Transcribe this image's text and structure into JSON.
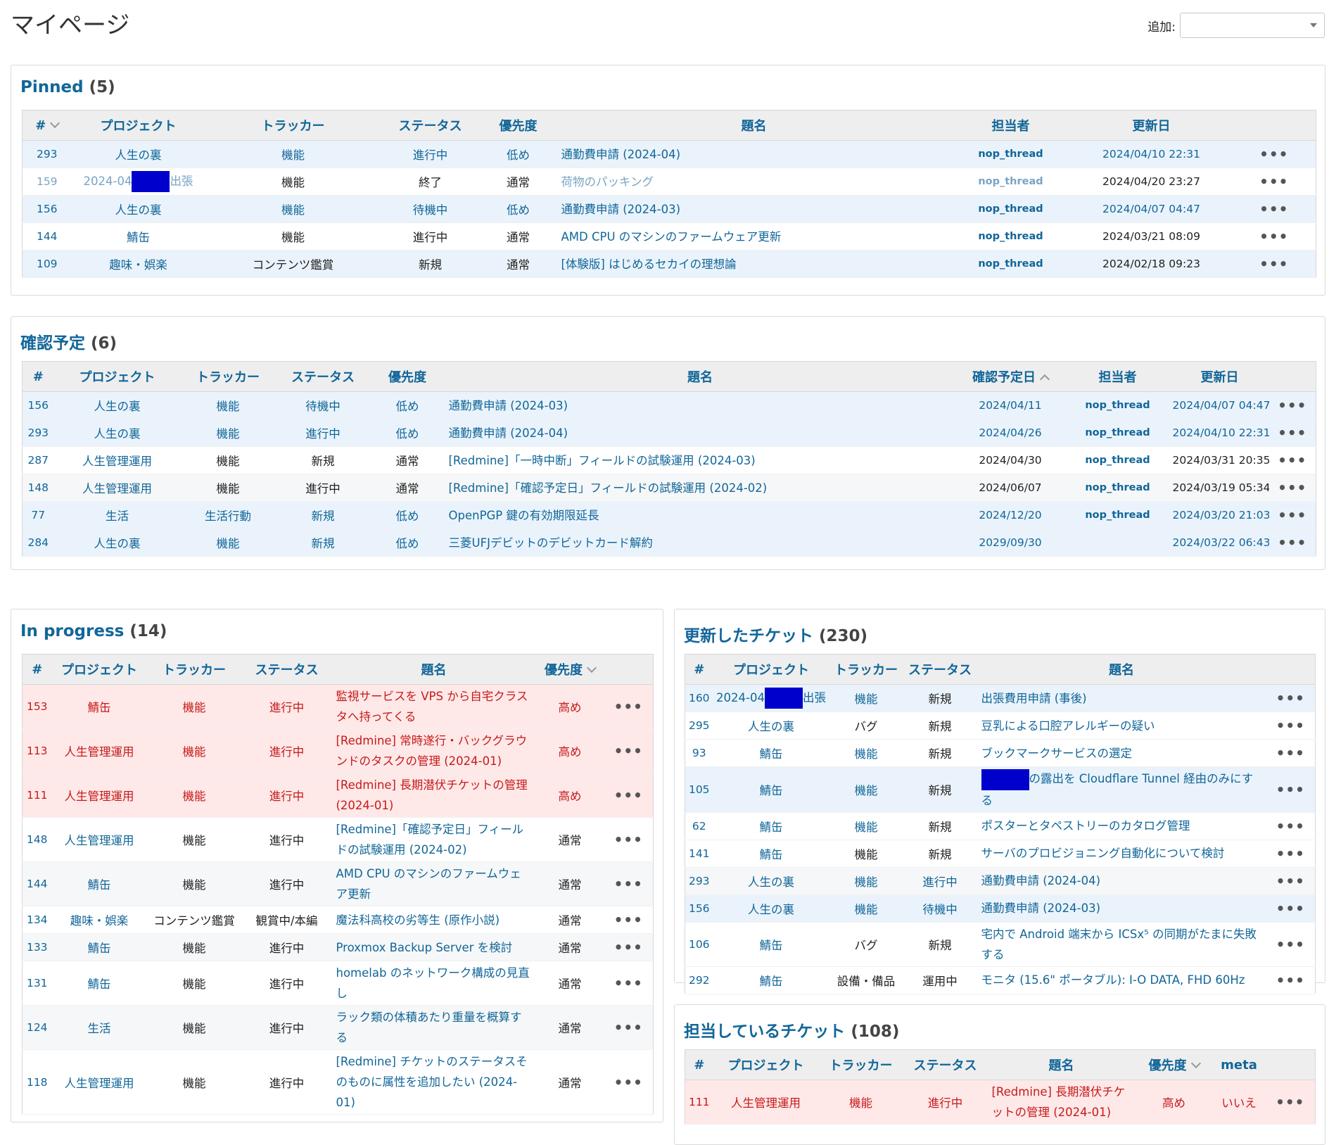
{
  "page": {
    "title": "マイページ",
    "add_label": "追加:",
    "add_value": ""
  },
  "pinned": {
    "title": "Pinned",
    "count": "(5)",
    "headers": [
      "#",
      "プロジェクト",
      "トラッカー",
      "ステータス",
      "優先度",
      "題名",
      "担当者",
      "更新日"
    ],
    "rows": [
      {
        "id": "293",
        "project": "人生の裏",
        "tracker": "機能",
        "status": "進行中",
        "priority": "低め",
        "subject": "通勤費申請 (2024-04)",
        "assignee": "nop_thread",
        "updated": "2024/04/10 22:31"
      },
      {
        "id": "159",
        "project_prefix": "2024-04",
        "project_suffix": "出張",
        "tracker": "機能",
        "status": "終了",
        "priority": "通常",
        "subject": "荷物のパッキング",
        "assignee": "nop_thread",
        "updated": "2024/04/20 23:27"
      },
      {
        "id": "156",
        "project": "人生の裏",
        "tracker": "機能",
        "status": "待機中",
        "priority": "低め",
        "subject": "通勤費申請 (2024-03)",
        "assignee": "nop_thread",
        "updated": "2024/04/07 04:47"
      },
      {
        "id": "144",
        "project": "鯖缶",
        "tracker": "機能",
        "status": "進行中",
        "priority": "通常",
        "subject": "AMD CPU のマシンのファームウェア更新",
        "assignee": "nop_thread",
        "updated": "2024/03/21 08:09"
      },
      {
        "id": "109",
        "project": "趣味・娯楽",
        "tracker": "コンテンツ鑑賞",
        "status": "新規",
        "priority": "通常",
        "subject": "[体験版] はじめるセカイの理想論",
        "assignee": "nop_thread",
        "updated": "2024/02/18 09:23"
      }
    ]
  },
  "review": {
    "title": "確認予定",
    "count": "(6)",
    "headers": [
      "#",
      "プロジェクト",
      "トラッカー",
      "ステータス",
      "優先度",
      "題名",
      "確認予定日",
      "担当者",
      "更新日"
    ],
    "rows": [
      {
        "id": "156",
        "project": "人生の裏",
        "tracker": "機能",
        "status": "待機中",
        "priority": "低め",
        "subject": "通勤費申請 (2024-03)",
        "due": "2024/04/11",
        "assignee": "nop_thread",
        "updated": "2024/04/07 04:47"
      },
      {
        "id": "293",
        "project": "人生の裏",
        "tracker": "機能",
        "status": "進行中",
        "priority": "低め",
        "subject": "通勤費申請 (2024-04)",
        "due": "2024/04/26",
        "assignee": "nop_thread",
        "updated": "2024/04/10 22:31"
      },
      {
        "id": "287",
        "project": "人生管理運用",
        "tracker": "機能",
        "status": "新規",
        "priority": "通常",
        "subject": "[Redmine]「一時中断」フィールドの試験運用 (2024-03)",
        "due": "2024/04/30",
        "assignee": "nop_thread",
        "updated": "2024/03/31 20:35"
      },
      {
        "id": "148",
        "project": "人生管理運用",
        "tracker": "機能",
        "status": "進行中",
        "priority": "通常",
        "subject": "[Redmine]「確認予定日」フィールドの試験運用 (2024-02)",
        "due": "2024/06/07",
        "assignee": "nop_thread",
        "updated": "2024/03/19 05:34"
      },
      {
        "id": "77",
        "project": "生活",
        "tracker": "生活行動",
        "status": "新規",
        "priority": "低め",
        "subject": "OpenPGP 鍵の有効期限延長",
        "due": "2024/12/20",
        "assignee": "nop_thread",
        "updated": "2024/03/20 21:03"
      },
      {
        "id": "284",
        "project": "人生の裏",
        "tracker": "機能",
        "status": "新規",
        "priority": "低め",
        "subject": "三菱UFJデビットのデビットカード解約",
        "due": "2029/09/30",
        "assignee": "",
        "updated": "2024/03/22 06:43"
      }
    ]
  },
  "in_progress": {
    "title": "In progress",
    "count": "(14)",
    "headers": [
      "#",
      "プロジェクト",
      "トラッカー",
      "ステータス",
      "題名",
      "優先度"
    ],
    "rows": [
      {
        "id": "153",
        "project": "鯖缶",
        "tracker": "機能",
        "status": "進行中",
        "subject": "監視サービスを VPS から自宅クラスタへ持ってくる",
        "priority": "高め"
      },
      {
        "id": "113",
        "project": "人生管理運用",
        "tracker": "機能",
        "status": "進行中",
        "subject": "[Redmine] 常時遂行・バックグラウンドのタスクの管理 (2024-01)",
        "priority": "高め"
      },
      {
        "id": "111",
        "project": "人生管理運用",
        "tracker": "機能",
        "status": "進行中",
        "subject": "[Redmine] 長期潜伏チケットの管理 (2024-01)",
        "priority": "高め"
      },
      {
        "id": "148",
        "project": "人生管理運用",
        "tracker": "機能",
        "status": "進行中",
        "subject": "[Redmine]「確認予定日」フィールドの試験運用 (2024-02)",
        "priority": "通常"
      },
      {
        "id": "144",
        "project": "鯖缶",
        "tracker": "機能",
        "status": "進行中",
        "subject": "AMD CPU のマシンのファームウェア更新",
        "priority": "通常"
      },
      {
        "id": "134",
        "project": "趣味・娯楽",
        "tracker": "コンテンツ鑑賞",
        "status": "観賞中/本編",
        "subject": "魔法科高校の劣等生 (原作小説)",
        "priority": "通常"
      },
      {
        "id": "133",
        "project": "鯖缶",
        "tracker": "機能",
        "status": "進行中",
        "subject": "Proxmox Backup Server を検討",
        "priority": "通常"
      },
      {
        "id": "131",
        "project": "鯖缶",
        "tracker": "機能",
        "status": "進行中",
        "subject": "homelab のネットワーク構成の見直し",
        "priority": "通常"
      },
      {
        "id": "124",
        "project": "生活",
        "tracker": "機能",
        "status": "進行中",
        "subject": "ラック類の体積あたり重量を概算する",
        "priority": "通常"
      },
      {
        "id": "118",
        "project": "人生管理運用",
        "tracker": "機能",
        "status": "進行中",
        "subject": "[Redmine] チケットのステータスそのものに属性を追加したい (2024-01)",
        "priority": "通常"
      }
    ]
  },
  "updated": {
    "title": "更新したチケット",
    "count": "(230)",
    "headers": [
      "#",
      "プロジェクト",
      "トラッカー",
      "ステータス",
      "題名"
    ],
    "rows": [
      {
        "id": "160",
        "project_prefix": "2024-04",
        "project_suffix": "出張",
        "tracker": "機能",
        "status": "新規",
        "subject": "出張費用申請 (事後)"
      },
      {
        "id": "295",
        "project": "人生の裏",
        "tracker": "バグ",
        "status": "新規",
        "subject": "豆乳による口腔アレルギーの疑い"
      },
      {
        "id": "93",
        "project": "鯖缶",
        "tracker": "機能",
        "status": "新規",
        "subject": "ブックマークサービスの選定"
      },
      {
        "id": "105",
        "project": "鯖缶",
        "tracker": "機能",
        "status": "新規",
        "subject": "の露出を Cloudflare Tunnel 経由のみにする"
      },
      {
        "id": "62",
        "project": "鯖缶",
        "tracker": "機能",
        "status": "新規",
        "subject": "ポスターとタペストリーのカタログ管理"
      },
      {
        "id": "141",
        "project": "鯖缶",
        "tracker": "機能",
        "status": "新規",
        "subject": "サーバのプロビジョニング自動化について検討"
      },
      {
        "id": "293",
        "project": "人生の裏",
        "tracker": "機能",
        "status": "進行中",
        "subject": "通勤費申請 (2024-04)"
      },
      {
        "id": "156",
        "project": "人生の裏",
        "tracker": "機能",
        "status": "待機中",
        "subject": "通勤費申請 (2024-03)"
      },
      {
        "id": "106",
        "project": "鯖缶",
        "tracker": "バグ",
        "status": "新規",
        "subject": "宅内で Android 端末から ICSx⁵ の同期がたまに失敗する"
      },
      {
        "id": "292",
        "project": "鯖缶",
        "tracker": "設備・備品",
        "status": "運用中",
        "subject": "モニタ (15.6\" ポータブル): I-O DATA, FHD 60Hz"
      }
    ]
  },
  "assigned": {
    "title": "担当しているチケット",
    "count": "(108)",
    "headers": [
      "#",
      "プロジェクト",
      "トラッカー",
      "ステータス",
      "題名",
      "優先度",
      "meta"
    ],
    "rows": [
      {
        "id": "111",
        "project": "人生管理運用",
        "tracker": "機能",
        "status": "進行中",
        "subject": "[Redmine] 長期潜伏チケットの管理 (2024-01)",
        "priority": "高め",
        "meta": "いいえ"
      }
    ]
  },
  "icons": {
    "row_menu": "•••"
  }
}
